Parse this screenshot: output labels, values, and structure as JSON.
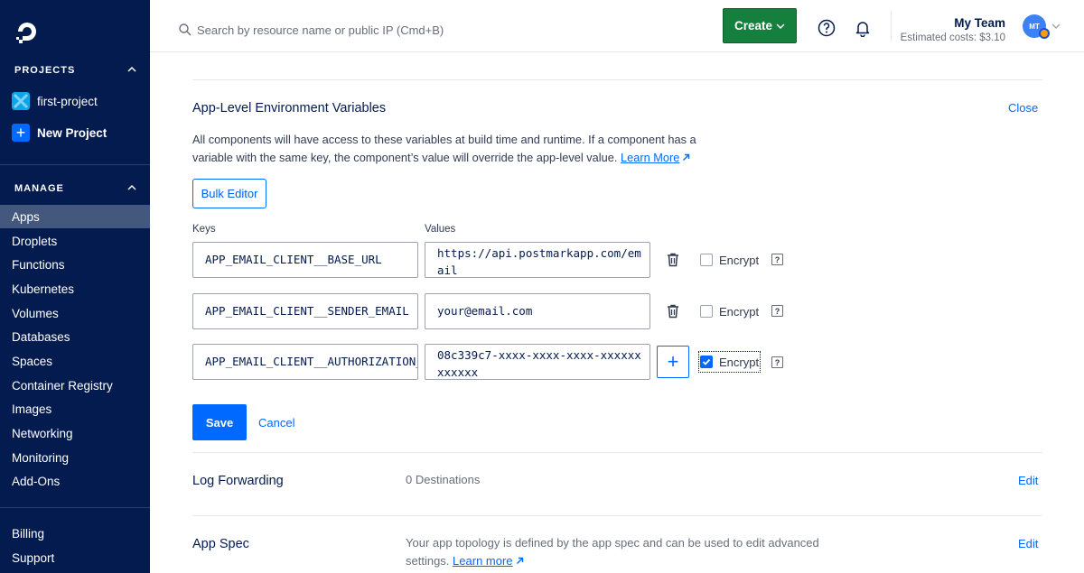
{
  "sidebar": {
    "projects_header": "PROJECTS",
    "projects": [
      {
        "label": "first-project"
      },
      {
        "label": "New Project"
      }
    ],
    "manage_header": "MANAGE",
    "manage_items": [
      {
        "label": "Apps",
        "active": true
      },
      {
        "label": "Droplets"
      },
      {
        "label": "Functions"
      },
      {
        "label": "Kubernetes"
      },
      {
        "label": "Volumes"
      },
      {
        "label": "Databases"
      },
      {
        "label": "Spaces"
      },
      {
        "label": "Container Registry"
      },
      {
        "label": "Images"
      },
      {
        "label": "Networking"
      },
      {
        "label": "Monitoring"
      },
      {
        "label": "Add-Ons"
      }
    ],
    "footer_items": [
      {
        "label": "Billing"
      },
      {
        "label": "Support"
      }
    ]
  },
  "header": {
    "search_placeholder": "Search by resource name or public IP (Cmd+B)",
    "create_label": "Create",
    "team_name": "My Team",
    "estimated_costs": "Estimated costs: $3.10",
    "avatar_initials": "MT"
  },
  "env_section": {
    "title": "App-Level Environment Variables",
    "close_label": "Close",
    "description": "All components will have access to these variables at build time and runtime. If a component has a variable with the same key, the component’s value will override the app-level value.",
    "learn_more": "Learn More",
    "bulk_editor_label": "Bulk Editor",
    "keys_label": "Keys",
    "values_label": "Values",
    "encrypt_label": "Encrypt",
    "help_glyph": "?",
    "add_glyph": "+",
    "rows": [
      {
        "key": "APP_EMAIL_CLIENT__BASE_URL",
        "value": "https://api.postmarkapp.com/email",
        "encrypted": false
      },
      {
        "key": "APP_EMAIL_CLIENT__SENDER_EMAIL",
        "value": "your@email.com",
        "encrypted": false
      },
      {
        "key": "APP_EMAIL_CLIENT__AUTHORIZATION_TOKEN",
        "value": "08c339c7-xxxx-xxxx-xxxx-xxxxxxxxxxxx",
        "encrypted": true
      }
    ],
    "save_label": "Save",
    "cancel_label": "Cancel"
  },
  "log_forwarding": {
    "label": "Log Forwarding",
    "value": "0 Destinations",
    "edit_label": "Edit"
  },
  "app_spec": {
    "label": "App Spec",
    "description": "Your app topology is defined by the app spec and can be used to edit advanced settings.",
    "learn_more": "Learn more",
    "edit_label": "Edit"
  },
  "colors": {
    "sidebar_bg": "#031b4e",
    "accent": "#0069ff",
    "create_green": "#15803d"
  }
}
